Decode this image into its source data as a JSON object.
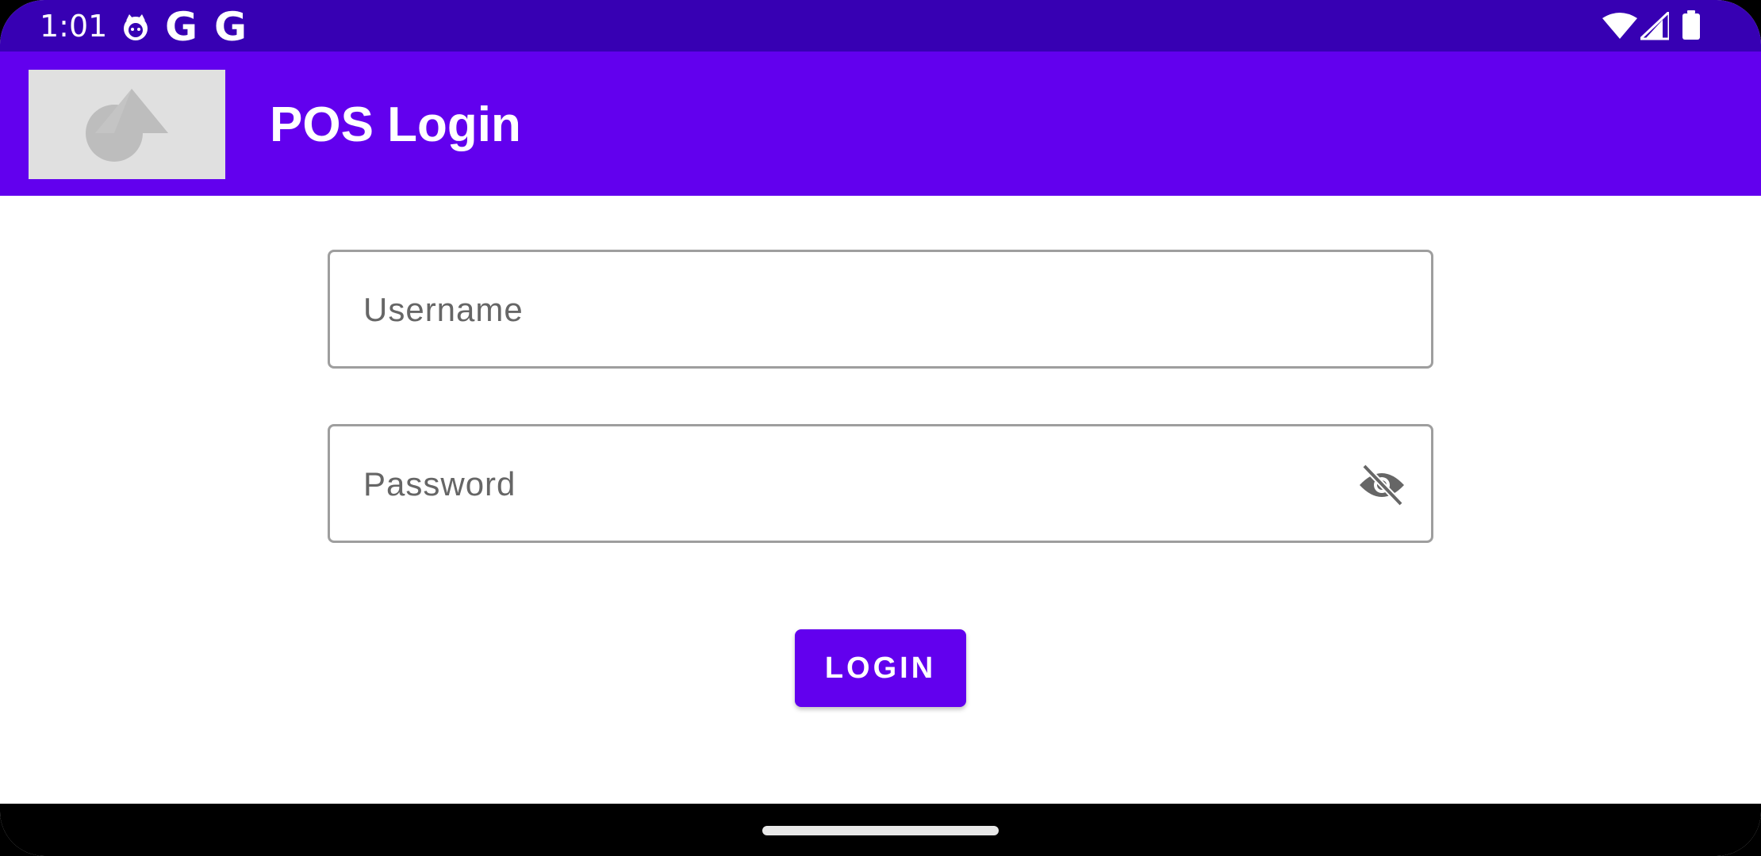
{
  "status_bar": {
    "time": "1:01",
    "icons": [
      "cat-notification-icon",
      "google-g-icon",
      "google-g-icon",
      "wifi-icon",
      "signal-icon",
      "battery-icon"
    ],
    "g_glyph": "G"
  },
  "app_bar": {
    "logo_icon": "image-placeholder-icon",
    "title": "POS Login"
  },
  "form": {
    "username": {
      "value": "",
      "placeholder": "Username"
    },
    "password": {
      "value": "",
      "placeholder": "Password",
      "toggle_icon": "eye-off-icon"
    },
    "login_label": "LOGIN"
  },
  "colors": {
    "status_bar": "#3700b3",
    "primary": "#6200ee",
    "field_border": "#9e9e9e",
    "placeholder": "#666666"
  }
}
